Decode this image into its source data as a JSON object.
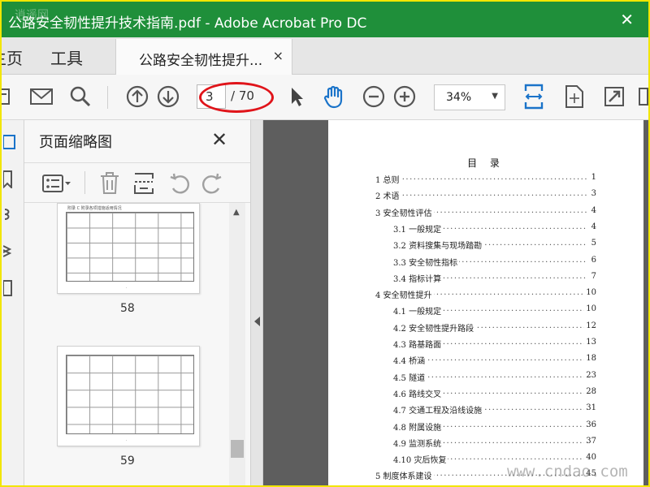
{
  "window": {
    "title": "公路安全韧性提升技术指南.pdf - Adobe Acrobat Pro DC",
    "close_glyph": "✕",
    "watermark_top": "逍遥网"
  },
  "tabs": {
    "home": "主页",
    "tools": "工具",
    "doc_tab": "公路安全韧性提升...",
    "doc_tab_close": "×"
  },
  "toolbar": {
    "icons": [
      "print-icon",
      "mail-icon",
      "search-icon",
      "page-up-icon",
      "page-down-icon",
      "select-arrow-icon",
      "hand-icon",
      "zoom-out-icon",
      "zoom-in-icon",
      "fit-width-icon",
      "fit-page-icon",
      "fullscreen-icon",
      "more-icon"
    ],
    "current_page": "3",
    "total_pages": "/ 70",
    "zoom": "34%"
  },
  "panel": {
    "title": "页面缩略图",
    "close": "✕",
    "thumbnails": [
      {
        "label": "58",
        "caption": "附录 C 附录各项措施适用情况"
      },
      {
        "label": "59",
        "caption": ""
      }
    ]
  },
  "document": {
    "toc_title": "目 录",
    "toc": [
      {
        "text": "1 总则",
        "page": "1",
        "level": 0
      },
      {
        "text": "2 术语",
        "page": "3",
        "level": 0
      },
      {
        "text": "3 安全韧性评估",
        "page": "4",
        "level": 0
      },
      {
        "text": "3.1 一般规定",
        "page": "4",
        "level": 1
      },
      {
        "text": "3.2 资料搜集与现场踏勘",
        "page": "5",
        "level": 1
      },
      {
        "text": "3.3 安全韧性指标",
        "page": "6",
        "level": 1
      },
      {
        "text": "3.4 指标计算",
        "page": "7",
        "level": 1
      },
      {
        "text": "4 安全韧性提升",
        "page": "10",
        "level": 0
      },
      {
        "text": "4.1 一般规定",
        "page": "10",
        "level": 1
      },
      {
        "text": "4.2 安全韧性提升路段",
        "page": "12",
        "level": 1
      },
      {
        "text": "4.3 路基路面",
        "page": "13",
        "level": 1
      },
      {
        "text": "4.4 桥涵",
        "page": "18",
        "level": 1
      },
      {
        "text": "4.5 隧道",
        "page": "23",
        "level": 1
      },
      {
        "text": "4.6 路线交叉",
        "page": "28",
        "level": 1
      },
      {
        "text": "4.7 交通工程及沿线设施",
        "page": "31",
        "level": 1
      },
      {
        "text": "4.8 附属设施",
        "page": "36",
        "level": 1
      },
      {
        "text": "4.9 监测系统",
        "page": "37",
        "level": 1
      },
      {
        "text": "4.10 灾后恢复",
        "page": "40",
        "level": 1
      },
      {
        "text": "5 制度体系建设",
        "page": "45",
        "level": 0
      }
    ]
  },
  "watermark_bottom": "www.cndao.com",
  "colors": {
    "titlebar": "#1f8f3a",
    "accent_blue": "#1a73c9",
    "annotation_red": "#e0141a"
  }
}
